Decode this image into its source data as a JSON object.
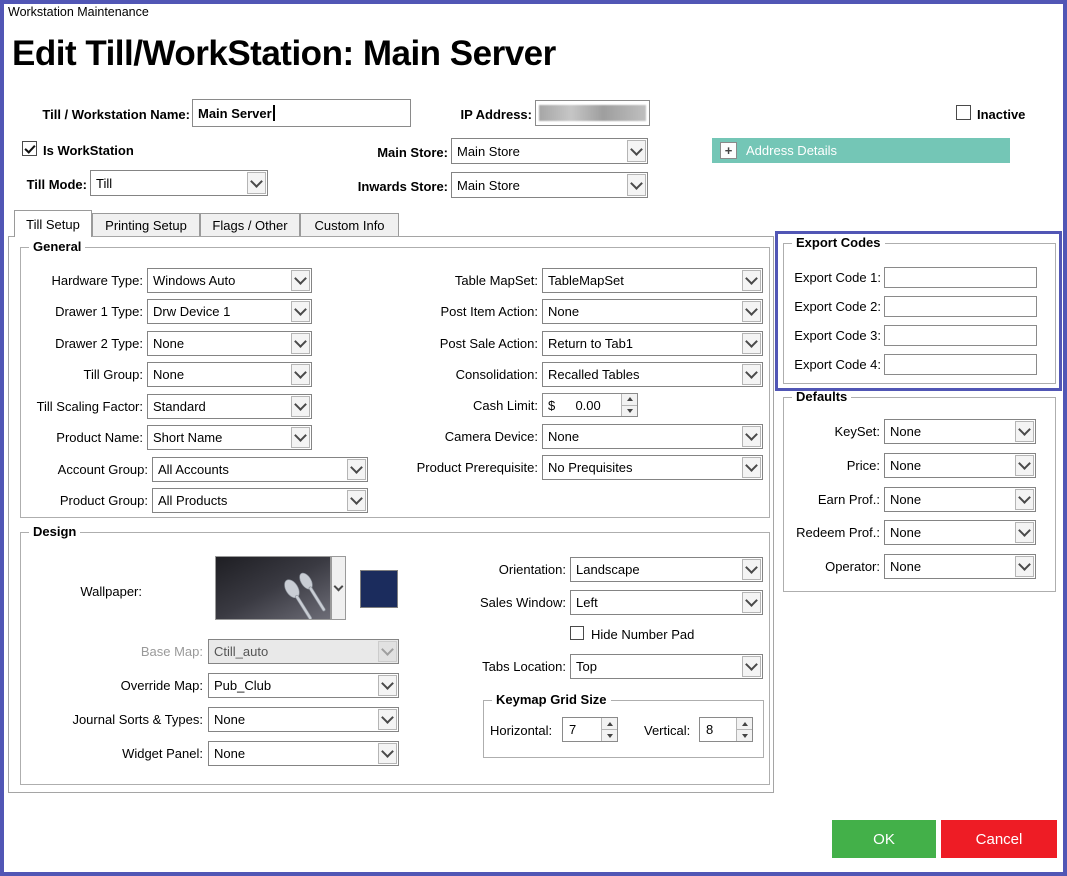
{
  "colors": {
    "highlight_border": "#5156b5",
    "address_button": "#74c6b6",
    "ok_button": "#43b049",
    "cancel_button": "#ee1c25",
    "wallpaper_swatch": "#1b2c5d"
  },
  "window": {
    "title": "Workstation Maintenance"
  },
  "header": {
    "title": "Edit Till/WorkStation: Main Server"
  },
  "top": {
    "name_label": "Till / Workstation Name:",
    "name_value": "Main Server",
    "ip_label": "IP Address:",
    "ip_value": "",
    "inactive_label": "Inactive",
    "inactive_checked": false,
    "is_workstation_label": "Is WorkStation",
    "is_workstation_checked": true,
    "main_store_label": "Main Store:",
    "main_store_value": "Main Store",
    "address_details_label": "Address Details",
    "address_details_icon": "+",
    "till_mode_label": "Till Mode:",
    "till_mode_value": "Till",
    "inwards_store_label": "Inwards Store:",
    "inwards_store_value": "Main Store"
  },
  "tabs": [
    {
      "label": "Till Setup",
      "selected": true
    },
    {
      "label": "Printing Setup",
      "selected": false
    },
    {
      "label": "Flags / Other",
      "selected": false
    },
    {
      "label": "Custom Info",
      "selected": false
    }
  ],
  "general": {
    "title": "General",
    "fields_left": [
      {
        "label": "Hardware Type:",
        "value": "Windows Auto"
      },
      {
        "label": "Drawer 1 Type:",
        "value": "Drw Device 1"
      },
      {
        "label": "Drawer 2 Type:",
        "value": "None"
      },
      {
        "label": "Till Group:",
        "value": "None"
      },
      {
        "label": "Till Scaling Factor:",
        "value": "Standard"
      },
      {
        "label": "Product Name:",
        "value": "Short Name"
      },
      {
        "label": "Account Group:",
        "value": "All Accounts"
      },
      {
        "label": "Product Group:",
        "value": "All Products"
      }
    ],
    "fields_right": [
      {
        "label": "Table MapSet:",
        "value": "TableMapSet"
      },
      {
        "label": "Post Item Action:",
        "value": "None"
      },
      {
        "label": "Post Sale Action:",
        "value": "Return to Tab1"
      },
      {
        "label": "Consolidation:",
        "value": "Recalled Tables"
      }
    ],
    "cash_limit": {
      "label": "Cash Limit:",
      "currency": "$",
      "value": "0.00"
    },
    "camera": {
      "label": "Camera Device:",
      "value": "None"
    },
    "prerequisite": {
      "label": "Product Prerequisite:",
      "value": "No Prequisites"
    }
  },
  "export_codes": {
    "title": "Export Codes",
    "fields": [
      {
        "label": "Export Code 1:",
        "value": ""
      },
      {
        "label": "Export Code 2:",
        "value": ""
      },
      {
        "label": "Export Code 3:",
        "value": ""
      },
      {
        "label": "Export Code 4:",
        "value": ""
      }
    ]
  },
  "defaults": {
    "title": "Defaults",
    "fields": [
      {
        "label": "KeySet:",
        "value": "None"
      },
      {
        "label": "Price:",
        "value": "None"
      },
      {
        "label": "Earn Prof.:",
        "value": "None"
      },
      {
        "label": "Redeem Prof.:",
        "value": "None"
      },
      {
        "label": "Operator:",
        "value": "None"
      }
    ]
  },
  "design": {
    "title": "Design",
    "wallpaper_label": "Wallpaper:",
    "base_map": {
      "label": "Base Map:",
      "value": "Ctill_auto",
      "disabled": true
    },
    "override_map": {
      "label": "Override Map:",
      "value": "Pub_Club"
    },
    "journal": {
      "label": "Journal Sorts & Types:",
      "value": "None"
    },
    "widget_panel": {
      "label": "Widget Panel:",
      "value": "None"
    },
    "orientation": {
      "label": "Orientation:",
      "value": "Landscape"
    },
    "sales_window": {
      "label": "Sales Window:",
      "value": "Left"
    },
    "hide_number_pad": {
      "label": "Hide Number Pad",
      "checked": false
    },
    "tabs_location": {
      "label": "Tabs Location:",
      "value": "Top"
    },
    "keymap": {
      "title": "Keymap Grid Size",
      "horizontal_label": "Horizontal:",
      "horizontal_value": "7",
      "vertical_label": "Vertical:",
      "vertical_value": "8"
    }
  },
  "buttons": {
    "ok": "OK",
    "cancel": "Cancel"
  }
}
